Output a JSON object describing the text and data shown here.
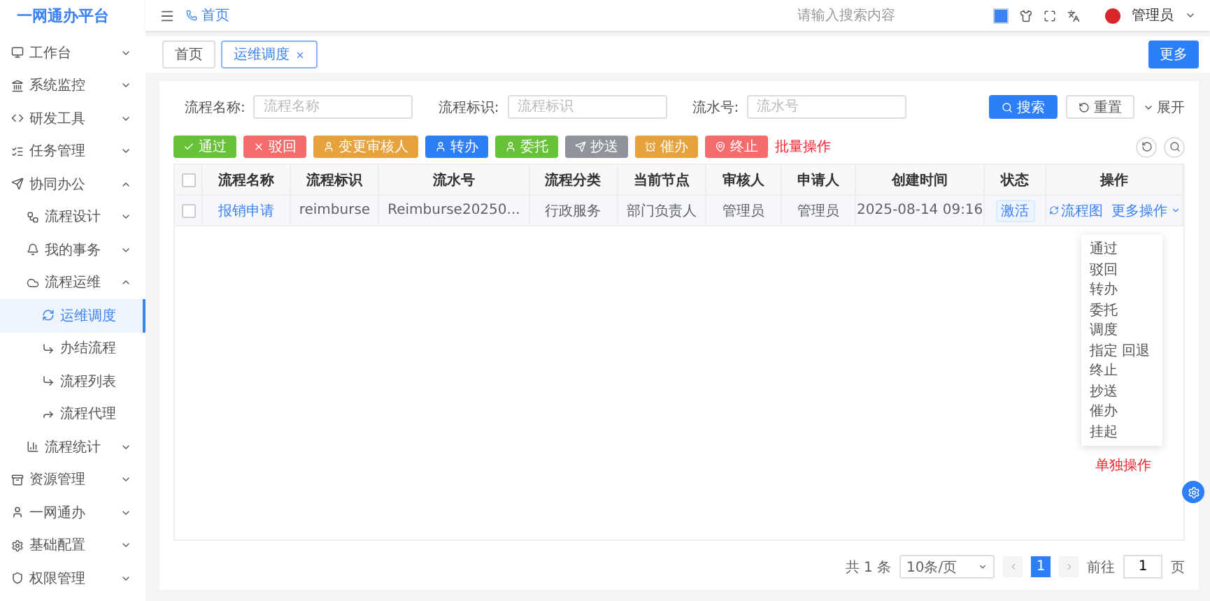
{
  "header": {
    "logo": "一网通办平台",
    "breadcrumb": "首页",
    "search": {
      "placeholder": "请输入搜索内容"
    },
    "user": "管理员"
  },
  "sidebar": {
    "items": [
      {
        "label": "工作台",
        "expanded": false,
        "selected": false
      },
      {
        "label": "系统监控",
        "expanded": false,
        "selected": false
      },
      {
        "label": "研发工具",
        "expanded": false,
        "selected": false
      },
      {
        "label": "任务管理",
        "expanded": false,
        "selected": false
      },
      {
        "label": "协同办公",
        "expanded": true,
        "selected": false,
        "children": [
          {
            "label": "流程设计",
            "expanded": false,
            "selected": false
          },
          {
            "label": "我的事务",
            "expanded": false,
            "selected": false
          },
          {
            "label": "流程运维",
            "expanded": true,
            "selected": false,
            "children": [
              {
                "label": "运维调度",
                "selected": true
              },
              {
                "label": "办结流程",
                "selected": false
              },
              {
                "label": "流程列表",
                "selected": false
              },
              {
                "label": "流程代理",
                "selected": false
              }
            ]
          },
          {
            "label": "流程统计",
            "expanded": false,
            "selected": false
          }
        ]
      },
      {
        "label": "资源管理",
        "expanded": false,
        "selected": false
      },
      {
        "label": "一网通办",
        "expanded": false,
        "selected": false
      },
      {
        "label": "基础配置",
        "expanded": false,
        "selected": false
      },
      {
        "label": "权限管理",
        "expanded": false,
        "selected": false
      }
    ]
  },
  "tabs": [
    {
      "label": "首页",
      "selected": false,
      "closable": false
    },
    {
      "label": "运维调度",
      "selected": true,
      "closable": true
    }
  ],
  "more_button": "更多",
  "filters": [
    {
      "label": "流程名称:",
      "placeholder": "流程名称"
    },
    {
      "label": "流程标识:",
      "placeholder": "流程标识"
    },
    {
      "label": "流水号:",
      "placeholder": "流水号"
    }
  ],
  "search_button": "搜索",
  "reset_button": "重置",
  "expand_link": "展开",
  "batch_buttons": [
    {
      "label": "通过",
      "kind": "check",
      "color": "#67c23a"
    },
    {
      "label": "驳回",
      "kind": "cross",
      "color": "#f56c6c"
    },
    {
      "label": "变更审核人",
      "kind": "user",
      "color": "#e6a23c"
    },
    {
      "label": "转办",
      "kind": "user",
      "color": "#2d7ff9"
    },
    {
      "label": "委托",
      "kind": "user",
      "color": "#67c23a"
    },
    {
      "label": "抄送",
      "kind": "send",
      "color": "#909399"
    },
    {
      "label": "催办",
      "kind": "alarm",
      "color": "#e6a23c"
    },
    {
      "label": "终止",
      "kind": "pin",
      "color": "#f56c6c"
    }
  ],
  "batch_note": "批量操作",
  "table": {
    "select_all": false,
    "columns": [
      "流程名称",
      "流程标识",
      "流水号",
      "流程分类",
      "当前节点",
      "审核人",
      "申请人",
      "创建时间",
      "状态",
      "操作"
    ],
    "rows": [
      {
        "checked": false,
        "cells": [
          "报销申请",
          "reimburse",
          "Reimburse20250...",
          "行政服务",
          "部门负责人",
          "管理员",
          "管理员",
          "2025-08-14 09:16"
        ],
        "status": "激活",
        "actions": [
          "流程图",
          "更多操作"
        ]
      }
    ]
  },
  "dropdown": {
    "items": [
      "通过",
      "驳回",
      "转办",
      "委托",
      "调度",
      "指定 回退",
      "终止",
      "抄送",
      "催办",
      "挂起"
    ]
  },
  "single_note": "单独操作",
  "pagination": {
    "total": "共 1 条",
    "page_size": "10条/页",
    "pages": [
      {
        "label": "1",
        "selected": true
      }
    ],
    "goto_label": "前往",
    "goto_value": "1",
    "page_suffix": "页"
  }
}
